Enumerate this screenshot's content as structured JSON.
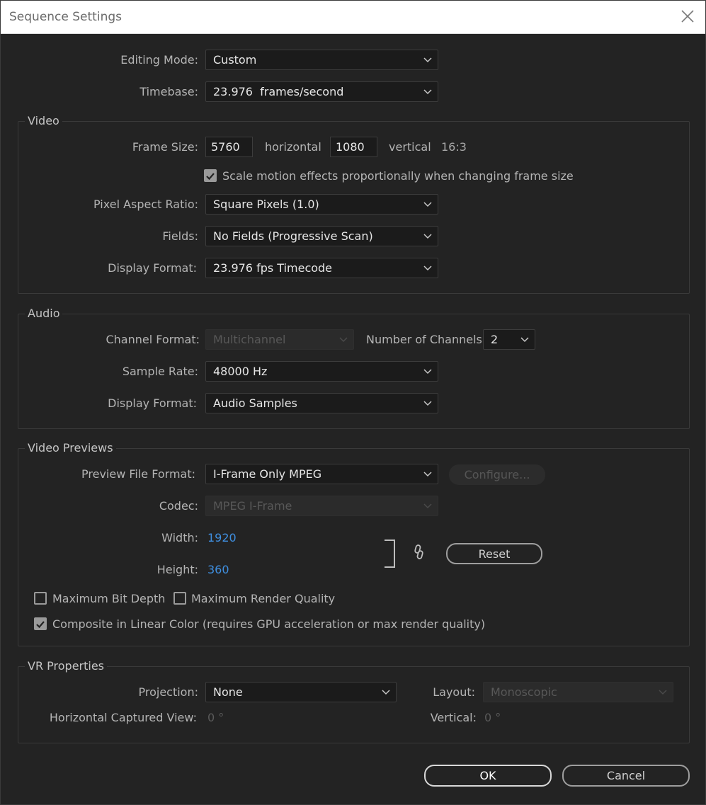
{
  "window": {
    "title": "Sequence Settings"
  },
  "general": {
    "editing_mode": {
      "label": "Editing Mode:",
      "value": "Custom"
    },
    "timebase": {
      "label": "Timebase:",
      "value": "23.976  frames/second"
    }
  },
  "video": {
    "title": "Video",
    "frame_size_label": "Frame Size:",
    "frame_width": "5760",
    "horizontal_label": "horizontal",
    "frame_height": "1080",
    "vertical_label": "vertical",
    "aspect_label": "16:3",
    "scale_checkbox": {
      "label": "Scale motion effects proportionally when changing frame size",
      "checked": true
    },
    "pixel_aspect": {
      "label": "Pixel Aspect Ratio:",
      "value": "Square Pixels (1.0)"
    },
    "fields": {
      "label": "Fields:",
      "value": "No Fields (Progressive Scan)"
    },
    "display_format": {
      "label": "Display Format:",
      "value": "23.976 fps Timecode"
    }
  },
  "audio": {
    "title": "Audio",
    "channel_format": {
      "label": "Channel Format:",
      "value": "Multichannel"
    },
    "num_channels": {
      "label": "Number of Channels:",
      "value": "2"
    },
    "sample_rate": {
      "label": "Sample Rate:",
      "value": "48000 Hz"
    },
    "display_format": {
      "label": "Display Format:",
      "value": "Audio Samples"
    }
  },
  "previews": {
    "title": "Video Previews",
    "file_format": {
      "label": "Preview File Format:",
      "value": "I-Frame Only MPEG"
    },
    "configure_label": "Configure...",
    "codec": {
      "label": "Codec:",
      "value": "MPEG I-Frame"
    },
    "width": {
      "label": "Width:",
      "value": "1920"
    },
    "height": {
      "label": "Height:",
      "value": "360"
    },
    "reset_label": "Reset",
    "max_bit_depth": {
      "label": "Maximum Bit Depth",
      "checked": false
    },
    "max_render_quality": {
      "label": "Maximum Render Quality",
      "checked": false
    },
    "composite_linear": {
      "label": "Composite in Linear Color (requires GPU acceleration or max render quality)",
      "checked": true
    }
  },
  "vr": {
    "title": "VR Properties",
    "projection": {
      "label": "Projection:",
      "value": "None"
    },
    "layout": {
      "label": "Layout:",
      "value": "Monoscopic"
    },
    "h_captured": {
      "label": "Horizontal Captured View:",
      "value": "0 °"
    },
    "vertical": {
      "label": "Vertical:",
      "value": "0 °"
    }
  },
  "buttons": {
    "ok": "OK",
    "cancel": "Cancel"
  },
  "colors": {
    "background": "#232323",
    "accent_blue": "#3f8fe0"
  }
}
